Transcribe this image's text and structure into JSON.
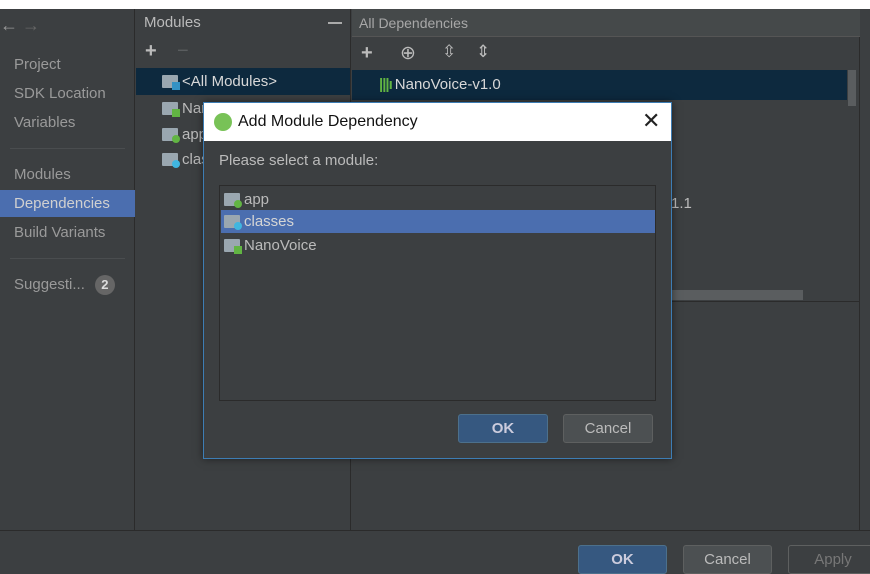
{
  "sidebar": {
    "items": [
      {
        "label": "Project"
      },
      {
        "label": "SDK Location"
      },
      {
        "label": "Variables"
      },
      {
        "label": "Modules"
      },
      {
        "label": "Dependencies",
        "selected": true
      },
      {
        "label": "Build Variants"
      },
      {
        "label": "Suggesti...",
        "badge": "2"
      }
    ]
  },
  "modules": {
    "title": "Modules",
    "items": [
      {
        "label": "<All Modules>",
        "selected": true
      },
      {
        "label": "NanoVoice"
      },
      {
        "label": "app"
      },
      {
        "label": "classes"
      }
    ]
  },
  "deps": {
    "title": "All Dependencies",
    "items": [
      {
        "label": "NanoVoice-v1.0",
        "selected": true
      }
    ],
    "partial_text": "1.1"
  },
  "dialog": {
    "title": "Add Module Dependency",
    "prompt": "Please select a module:",
    "items": [
      {
        "label": "app"
      },
      {
        "label": "classes",
        "selected": true
      },
      {
        "label": "NanoVoice"
      }
    ],
    "ok": "OK",
    "cancel": "Cancel"
  },
  "footer": {
    "ok": "OK",
    "cancel": "Cancel",
    "apply": "Apply"
  },
  "colors": {
    "selection": "#4b6eaf",
    "tree_selection": "#0d293e",
    "primary_button": "#365880"
  }
}
